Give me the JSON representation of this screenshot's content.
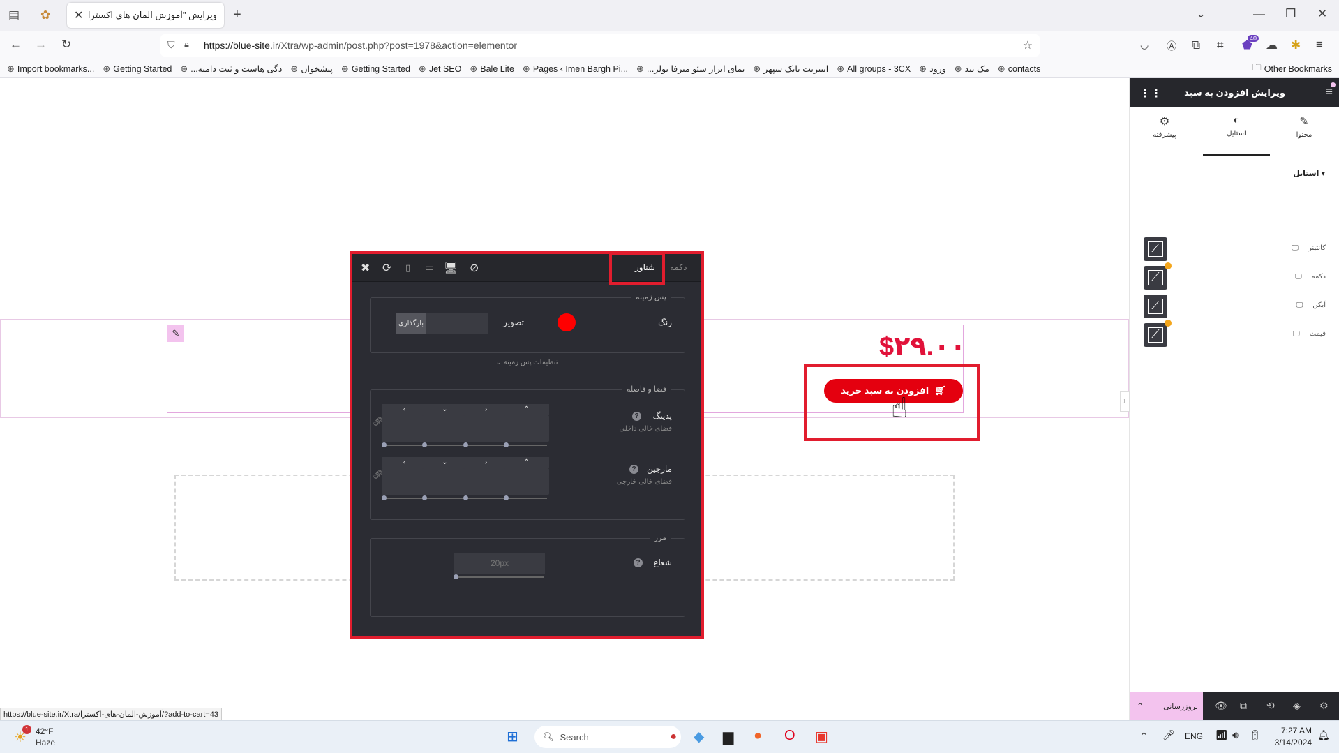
{
  "browser": {
    "tab_title": "ویرایش \"آموزش المان های اکسترا – ...",
    "url_host": "https://blue-site.ir",
    "url_path": "/Xtra/wp-admin/post.php?post=1978&action=elementor",
    "bookmarks": [
      "Import bookmarks...",
      "Getting Started",
      "...دگی هاست و ثبت دامنه",
      "پیشخوان",
      "Getting Started",
      "Jet SEO",
      "Bale Lite",
      "Pages ‹ Imen Bargh Pi...",
      "...نمای ابزار سئو میزفا تولز",
      "اینترنت بانک سپهر",
      "All groups - 3CX",
      "ورود",
      "مک نید",
      "contacts"
    ],
    "other_bookmarks": "Other Bookmarks",
    "ext_badge": "40"
  },
  "canvas": {
    "price": "$۲۹.۰۰",
    "add_to_cart": "افزودن به سبد خرید",
    "status_url": "https://blue-site.ir/Xtra/آموزش-المان-های-اکسترا/?add-to-cart=43"
  },
  "popup": {
    "tab_button": "دکمه",
    "tab_hover": "شناور",
    "bg_group": "پس زمینه",
    "color_label": "رنگ",
    "color_value": "#ff0000",
    "image_label": "تصویر",
    "upload_label": "بارگذاری",
    "bg_settings": "تنظیمات پس زمینه",
    "spacing_group": "فضا و فاصله",
    "padding_label": "پدینگ",
    "padding_sub": "فضای خالی داخلی",
    "margin_label": "مارجین",
    "margin_sub": "فضای خالی خارجی",
    "border_group": "مرز",
    "radius_label": "شعاع",
    "radius_placeholder": "20px"
  },
  "panel": {
    "title": "ویرایش افزودن به سبد",
    "tabs": [
      "محتوا",
      "استایل",
      "پیشرفته"
    ],
    "active_tab": "استایل",
    "section": "استایل",
    "rows": [
      "کانتینر",
      "دکمه",
      "آیکن",
      "قیمت"
    ],
    "publish": "بروزرسانی"
  },
  "taskbar": {
    "temp": "42°F",
    "weather": "Haze",
    "weather_badge": "1",
    "search": "Search",
    "lang": "ENG",
    "time": "7:27 AM",
    "date": "3/14/2024"
  }
}
